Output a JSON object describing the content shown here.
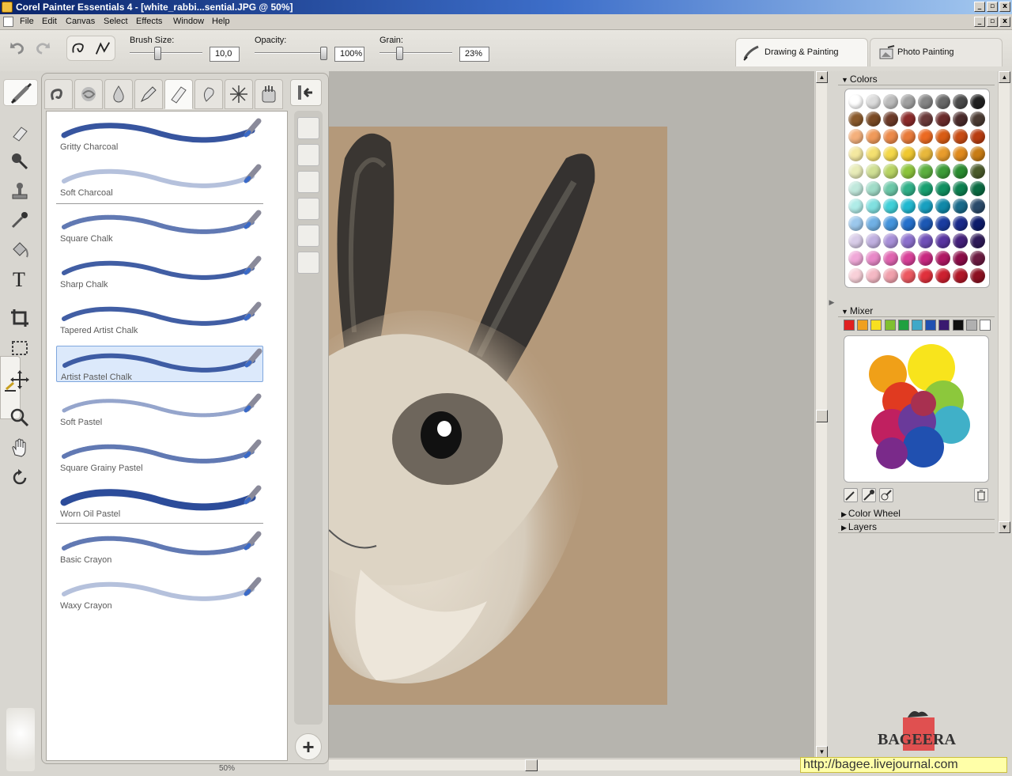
{
  "window": {
    "title": "Corel Painter Essentials 4 - [white_rabbi...sential.JPG @ 50%]",
    "controls": [
      "_",
      "▫",
      "x"
    ]
  },
  "menu": [
    "File",
    "Edit",
    "Canvas",
    "Select",
    "Effects",
    "Window",
    "Help"
  ],
  "toolbar": {
    "brush_size": {
      "label": "Brush Size:",
      "value": "10,0"
    },
    "opacity": {
      "label": "Opacity:",
      "value": "100%"
    },
    "grain": {
      "label": "Grain:",
      "value": "23%"
    },
    "modes": [
      {
        "label": "Drawing & Painting",
        "active": true
      },
      {
        "label": "Photo Painting",
        "active": false
      }
    ]
  },
  "tools": [
    "eraser-icon",
    "dropper-magnifier-icon",
    "stamp-icon",
    "eyedropper-icon",
    "paint-bucket-icon",
    "text-icon",
    "crop-icon",
    "selection-icon",
    "move-icon",
    "magnifier-icon",
    "grabber-hand-icon",
    "rotate-icon"
  ],
  "brush_categories": [
    "pens",
    "blenders",
    "watercolor",
    "pencils",
    "chalk",
    "airbrush",
    "spray",
    "art-pen"
  ],
  "brush_variants": [
    {
      "name": "Gritty Charcoal",
      "style": "gritty"
    },
    {
      "name": "Soft Charcoal",
      "style": "soft"
    },
    {
      "name": "Square Chalk",
      "style": "grainy"
    },
    {
      "name": "Sharp Chalk",
      "style": "tapered"
    },
    {
      "name": "Tapered Artist Chalk",
      "style": "tapered"
    },
    {
      "name": "Artist Pastel Chalk",
      "style": "tapered",
      "selected": true
    },
    {
      "name": "Soft Pastel",
      "style": "soft-grainy"
    },
    {
      "name": "Square Grainy Pastel",
      "style": "grainy"
    },
    {
      "name": "Worn Oil Pastel",
      "style": "bold"
    },
    {
      "name": "Basic Crayon",
      "style": "grainy"
    },
    {
      "name": "Waxy Crayon",
      "style": "soft"
    }
  ],
  "colors": {
    "title": "Colors",
    "swatches": [
      [
        "#ffffff",
        "#dcdcdc",
        "#bcbcbc",
        "#a0a0a0",
        "#858585",
        "#686868",
        "#4a4a4a",
        "#202020"
      ],
      [
        "#8a5a2c",
        "#7a4a24",
        "#6c3a28",
        "#8a2a2a",
        "#6a3a3a",
        "#6a2a2a",
        "#4a2a2a",
        "#4a3a32"
      ],
      [
        "#f4b07c",
        "#f09a5a",
        "#ec8a4a",
        "#e87a3a",
        "#ec6a22",
        "#d85c14",
        "#c84c14",
        "#b83c10"
      ],
      [
        "#f4e8a0",
        "#f4e070",
        "#f4d84a",
        "#f0c830",
        "#e8b83c",
        "#e89c2c",
        "#e08a1c",
        "#c87c14"
      ],
      [
        "#e8ecb8",
        "#d0e094",
        "#b8d464",
        "#8cc43c",
        "#5cb040",
        "#3c9c38",
        "#2a8c30",
        "#4a5a2a"
      ],
      [
        "#c0e8dc",
        "#a0dcc8",
        "#6cc8a8",
        "#30b088",
        "#18a070",
        "#109060",
        "#0c8050",
        "#0a6a42"
      ],
      [
        "#b0ece8",
        "#80e0e0",
        "#40d0d8",
        "#20b8d0",
        "#18a0c0",
        "#1088a8",
        "#1a6a8a",
        "#2a4a6a"
      ],
      [
        "#9cc8ec",
        "#70b0e4",
        "#4494dc",
        "#2470cc",
        "#1c58b4",
        "#1a3ca0",
        "#1a2a8a",
        "#0c1a6a"
      ],
      [
        "#d8cce8",
        "#c0b0e0",
        "#a890d8",
        "#8c70cc",
        "#7050b8",
        "#5834a0",
        "#44207a",
        "#2e1a58"
      ],
      [
        "#f0a8d8",
        "#e888c8",
        "#e064b0",
        "#d84098",
        "#c82880",
        "#b01864",
        "#8c0c48",
        "#6a1a40"
      ],
      [
        "#f8d0d8",
        "#f4b8c4",
        "#f0a0ac",
        "#ec5860",
        "#e0303c",
        "#cc2030",
        "#b01828",
        "#8c1020"
      ]
    ]
  },
  "mixer": {
    "title": "Mixer",
    "chips": [
      "#e02020",
      "#f0a020",
      "#f8e020",
      "#80c030",
      "#20a040",
      "#40a8c8",
      "#2050b0",
      "#3a1a70",
      "#101010",
      "#b0b0b0",
      "#ffffff"
    ],
    "tools": [
      "dirty-brush-icon",
      "mixer-dropper-icon",
      "sample-multiple-icon",
      "trash-icon"
    ]
  },
  "collapsed_panels": [
    "Color Wheel",
    "Layers"
  ],
  "zoom_status": "50%",
  "watermark": {
    "text": "BAGEERA",
    "url": "http://bagee.livejournal.com"
  }
}
